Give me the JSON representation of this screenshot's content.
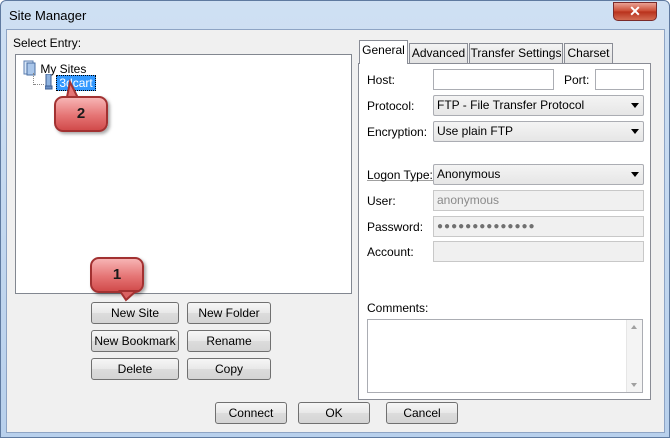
{
  "window": {
    "title": "Site Manager",
    "close_glyph": "✕"
  },
  "left": {
    "select_entry_label": "Select Entry:",
    "tree": [
      {
        "label": "My Sites",
        "icon": "folder-icon"
      },
      {
        "label": "3dcart",
        "icon": "server-icon",
        "selected": true
      }
    ],
    "buttons": {
      "new_site": "New Site",
      "new_folder": "New Folder",
      "new_bookmark": "New Bookmark",
      "rename": "Rename",
      "delete": "Delete",
      "copy": "Copy"
    }
  },
  "tabs": [
    "General",
    "Advanced",
    "Transfer Settings",
    "Charset"
  ],
  "active_tab": "General",
  "general": {
    "host_label": "Host:",
    "host_value": "",
    "port_label": "Port:",
    "port_value": "",
    "protocol_label": "Protocol:",
    "protocol_value": "FTP - File Transfer Protocol",
    "encryption_label": "Encryption:",
    "encryption_value": "Use plain FTP",
    "logon_type_label": "Logon Type:",
    "logon_type_value": "Anonymous",
    "user_label": "User:",
    "user_value": "anonymous",
    "password_label": "Password:",
    "password_value": "●●●●●●●●●●●●●●",
    "account_label": "Account:",
    "account_value": "",
    "comments_label": "Comments:"
  },
  "footer": {
    "connect": "Connect",
    "ok": "OK",
    "cancel": "Cancel"
  },
  "callouts": {
    "one": "1",
    "two": "2"
  },
  "colors": {
    "selection": "#3399ff",
    "callout": "#e57474",
    "close": "#c9472f"
  }
}
